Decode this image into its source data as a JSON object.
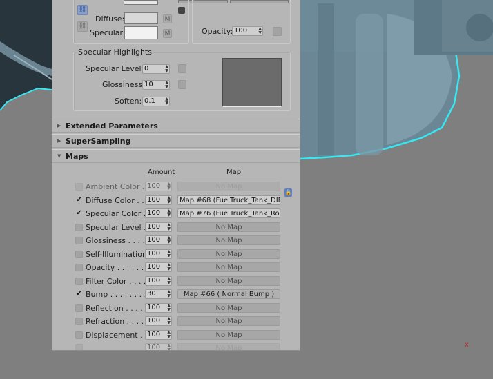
{
  "basic": {
    "diffuse_label": "Diffuse:",
    "specular_label": "Specular:",
    "m_label": "M",
    "opacity_label": "Opacity:",
    "opacity_value": "100",
    "specular_highlights": {
      "title": "Specular Highlights",
      "level_label": "Specular Level:",
      "level_value": "0",
      "gloss_label": "Glossiness:",
      "gloss_value": "10",
      "soften_label": "Soften:",
      "soften_value": "0.1"
    }
  },
  "rollouts": {
    "extended": "Extended Parameters",
    "supersampling": "SuperSampling",
    "maps": "Maps"
  },
  "maps": {
    "amount_header": "Amount",
    "map_header": "Map",
    "rows": [
      {
        "name": "Ambient Color . .",
        "checked": false,
        "amount": "100",
        "map": "No Map",
        "assigned": false,
        "dim": true
      },
      {
        "name": "Diffuse Color . . .",
        "checked": true,
        "amount": "100",
        "map": "Map #68 (FuelTruck_Tank_DIF",
        "assigned": true
      },
      {
        "name": "Specular Color . .",
        "checked": true,
        "amount": "100",
        "map": "Map #76 (FuelTruck_Tank_Rou",
        "assigned": true
      },
      {
        "name": "Specular Level  .",
        "checked": false,
        "amount": "100",
        "map": "No Map",
        "assigned": false
      },
      {
        "name": "Glossiness . . . .",
        "checked": false,
        "amount": "100",
        "map": "No Map",
        "assigned": false
      },
      {
        "name": "Self-Illumination .",
        "checked": false,
        "amount": "100",
        "map": "No Map",
        "assigned": false
      },
      {
        "name": "Opacity . . . . . .",
        "checked": false,
        "amount": "100",
        "map": "No Map",
        "assigned": false
      },
      {
        "name": "Filter Color  . . . .",
        "checked": false,
        "amount": "100",
        "map": "No Map",
        "assigned": false
      },
      {
        "name": "Bump  . . . . . . . .",
        "checked": true,
        "amount": "30",
        "map": "Map #66  ( Normal Bump )",
        "assigned": false,
        "center": true
      },
      {
        "name": "Reflection  . . . .",
        "checked": false,
        "amount": "100",
        "map": "No Map",
        "assigned": false
      },
      {
        "name": "Refraction  . . . .",
        "checked": false,
        "amount": "100",
        "map": "No Map",
        "assigned": false
      },
      {
        "name": "Displacement  . .",
        "checked": false,
        "amount": "100",
        "map": "No Map",
        "assigned": false
      },
      {
        "name": "",
        "checked": false,
        "amount": "100",
        "map": "No Map",
        "assigned": false,
        "dim": true
      }
    ]
  },
  "viewport": {
    "axis_label": "x"
  }
}
